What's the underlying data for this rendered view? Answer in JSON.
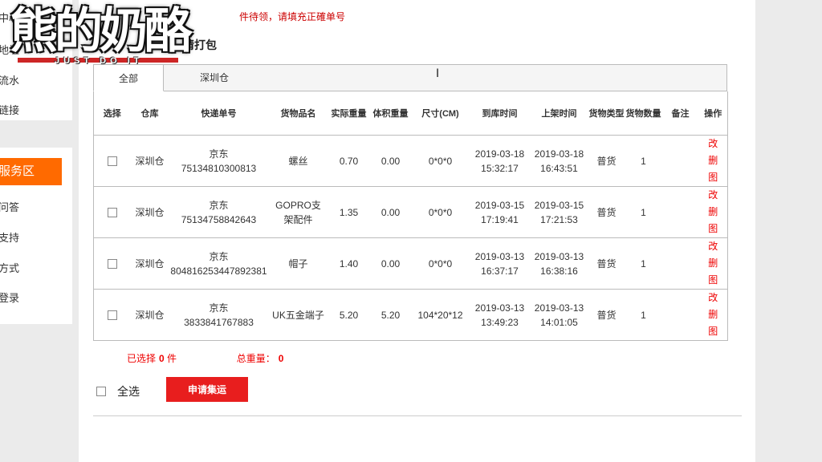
{
  "logo": {
    "main": "熊的奶酪",
    "sub": "JUST DO IT"
  },
  "sidebar": {
    "top_items": [
      "中心",
      "地址",
      "流水",
      "链接"
    ],
    "service_head": "服务区",
    "service_items": [
      "问答",
      "支持",
      "方式",
      "登录"
    ]
  },
  "notice": "件待领，请填充正確单号",
  "section_title": "请打包",
  "tabs": [
    {
      "label": "全部"
    },
    {
      "label": "深圳仓"
    }
  ],
  "table": {
    "headers": [
      "选择",
      "仓库",
      "快递单号",
      "货物品名",
      "实际重量",
      "体积重量",
      "尺寸(CM)",
      "到库时间",
      "上架时间",
      "货物类型",
      "货物数量",
      "备注",
      "操作"
    ],
    "rows": [
      {
        "warehouse": "深圳仓",
        "carrier": "京东",
        "tracking": "75134810300813",
        "name": "螺丝",
        "weight": "0.70",
        "vol_weight": "0.00",
        "size": "0*0*0",
        "arrive_date": "2019-03-18",
        "arrive_time": "15:32:17",
        "shelf_date": "2019-03-18",
        "shelf_time": "16:43:51",
        "type": "普货",
        "qty": "1",
        "note": ""
      },
      {
        "warehouse": "深圳仓",
        "carrier": "京东",
        "tracking": "75134758842643",
        "name_l1": "GOPRO支",
        "name_l2": "架配件",
        "weight": "1.35",
        "vol_weight": "0.00",
        "size": "0*0*0",
        "arrive_date": "2019-03-15",
        "arrive_time": "17:19:41",
        "shelf_date": "2019-03-15",
        "shelf_time": "17:21:53",
        "type": "普货",
        "qty": "1",
        "note": ""
      },
      {
        "warehouse": "深圳仓",
        "carrier": "京东",
        "tracking": "804816253447892381",
        "name": "帽子",
        "weight": "1.40",
        "vol_weight": "0.00",
        "size": "0*0*0",
        "arrive_date": "2019-03-13",
        "arrive_time": "16:37:17",
        "shelf_date": "2019-03-13",
        "shelf_time": "16:38:16",
        "type": "普货",
        "qty": "1",
        "note": ""
      },
      {
        "warehouse": "深圳仓",
        "carrier": "京东",
        "tracking": "3833841767883",
        "name": "UK五金端子",
        "weight": "5.20",
        "vol_weight": "5.20",
        "size": "104*20*12",
        "arrive_date": "2019-03-13",
        "arrive_time": "13:49:23",
        "shelf_date": "2019-03-13",
        "shelf_time": "14:01:05",
        "type": "普货",
        "qty": "1",
        "note": ""
      }
    ],
    "ops": [
      "改",
      "删",
      "图"
    ]
  },
  "summary": {
    "selected_label": "已选择",
    "selected_count": "0",
    "unit": "件",
    "weight_label": "总重量：",
    "weight_value": "0"
  },
  "footer": {
    "select_all": "全选",
    "apply_button": "申请集运"
  },
  "colors": {
    "accent": "#ff6a00",
    "danger": "#e81e1e",
    "link": "#e00000"
  },
  "icons": {
    "cursor": "text-cursor-icon"
  }
}
